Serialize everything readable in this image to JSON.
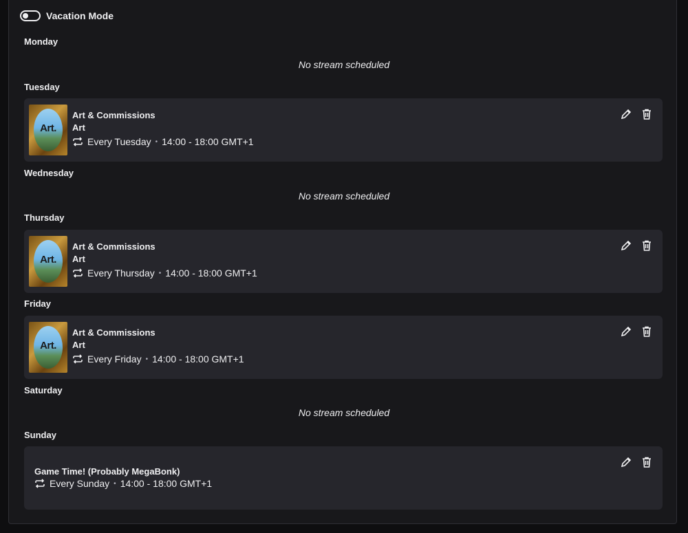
{
  "vacation": {
    "label": "Vacation Mode",
    "enabled": false
  },
  "days": {
    "monday": {
      "name": "Monday",
      "empty_text": "No stream scheduled"
    },
    "tuesday": {
      "name": "Tuesday",
      "title": "Art & Commissions",
      "category": "Art",
      "recurrence": "Every Tuesday",
      "time": "14:00 - 18:00 GMT+1",
      "thumb_text": "Art."
    },
    "wednesday": {
      "name": "Wednesday",
      "empty_text": "No stream scheduled"
    },
    "thursday": {
      "name": "Thursday",
      "title": "Art & Commissions",
      "category": "Art",
      "recurrence": "Every Thursday",
      "time": "14:00 - 18:00 GMT+1",
      "thumb_text": "Art."
    },
    "friday": {
      "name": "Friday",
      "title": "Art & Commissions",
      "category": "Art",
      "recurrence": "Every Friday",
      "time": "14:00 - 18:00 GMT+1",
      "thumb_text": "Art."
    },
    "saturday": {
      "name": "Saturday",
      "empty_text": "No stream scheduled"
    },
    "sunday": {
      "name": "Sunday",
      "title": "Game Time! (Probably MegaBonk)",
      "recurrence": "Every Sunday",
      "time": "14:00 - 18:00 GMT+1"
    }
  },
  "separator": "•",
  "icons": {
    "repeat": "repeat-icon",
    "edit": "pencil-icon",
    "delete": "trash-icon"
  }
}
